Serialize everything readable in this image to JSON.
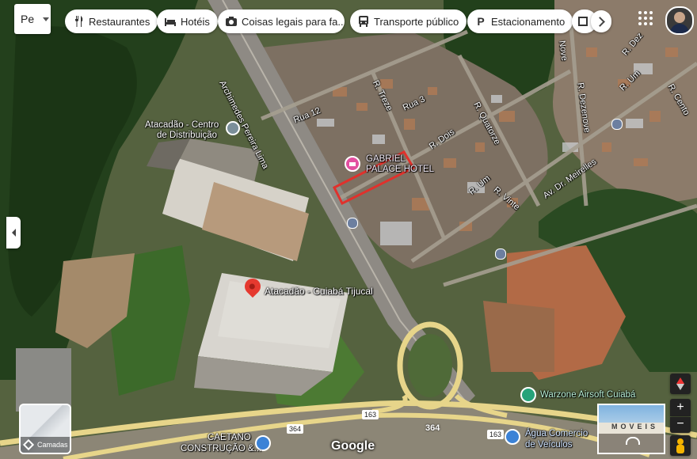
{
  "search": {
    "value": "Pe"
  },
  "chips": [
    {
      "label": "Restaurantes",
      "icon": "fork-knife-icon"
    },
    {
      "label": "Hotéis",
      "icon": "bed-icon"
    },
    {
      "label": "Coisas legais para fa...",
      "icon": "camera-icon"
    },
    {
      "label": "Transporte público",
      "icon": "bus-icon"
    },
    {
      "label": "Estacionamento",
      "icon": "parking-icon"
    }
  ],
  "places": {
    "atacadao_cd_line1": "Atacadão - Centro",
    "atacadao_cd_line2": "de Distribuição",
    "gabriel_line1": "GABRIEL",
    "gabriel_line2": "PALACE HOTEL",
    "atacadao_tijucal": "Atacadão - Cuiabá Tijucal",
    "warzone": "Warzone Airsoft Cuiabá",
    "caetano_line1": "CAETANO",
    "caetano_line2": "CONSTRUÇÃO &...",
    "agua_line1": "Água Comercio",
    "agua_line2": "de Veículos"
  },
  "streets": {
    "archimedes": "Archimedes Pereira Lima",
    "rua12": "Rua 12",
    "rtreze": "R. Treze",
    "rua3": "Rua 3",
    "rdois": "R. Dois",
    "rquatorze": "R. Quatorze",
    "rum_a": "R. Um",
    "rvinte": "R. Vinte",
    "avmeirelles": "Av. Dr. Meirelles",
    "rdezenove": "R. Dezenove",
    "rdez": "R. Dez",
    "rum_b": "R. Um",
    "rcento": "R. Cento",
    "nove": "Nove",
    "shield163a": "163",
    "shield364a": "364",
    "shield364b": "364",
    "shield163b": "163"
  },
  "layers": {
    "label": "Camadas"
  },
  "streetview": {
    "label": "MOVEIS"
  },
  "attribution": {
    "logo": "Google"
  }
}
